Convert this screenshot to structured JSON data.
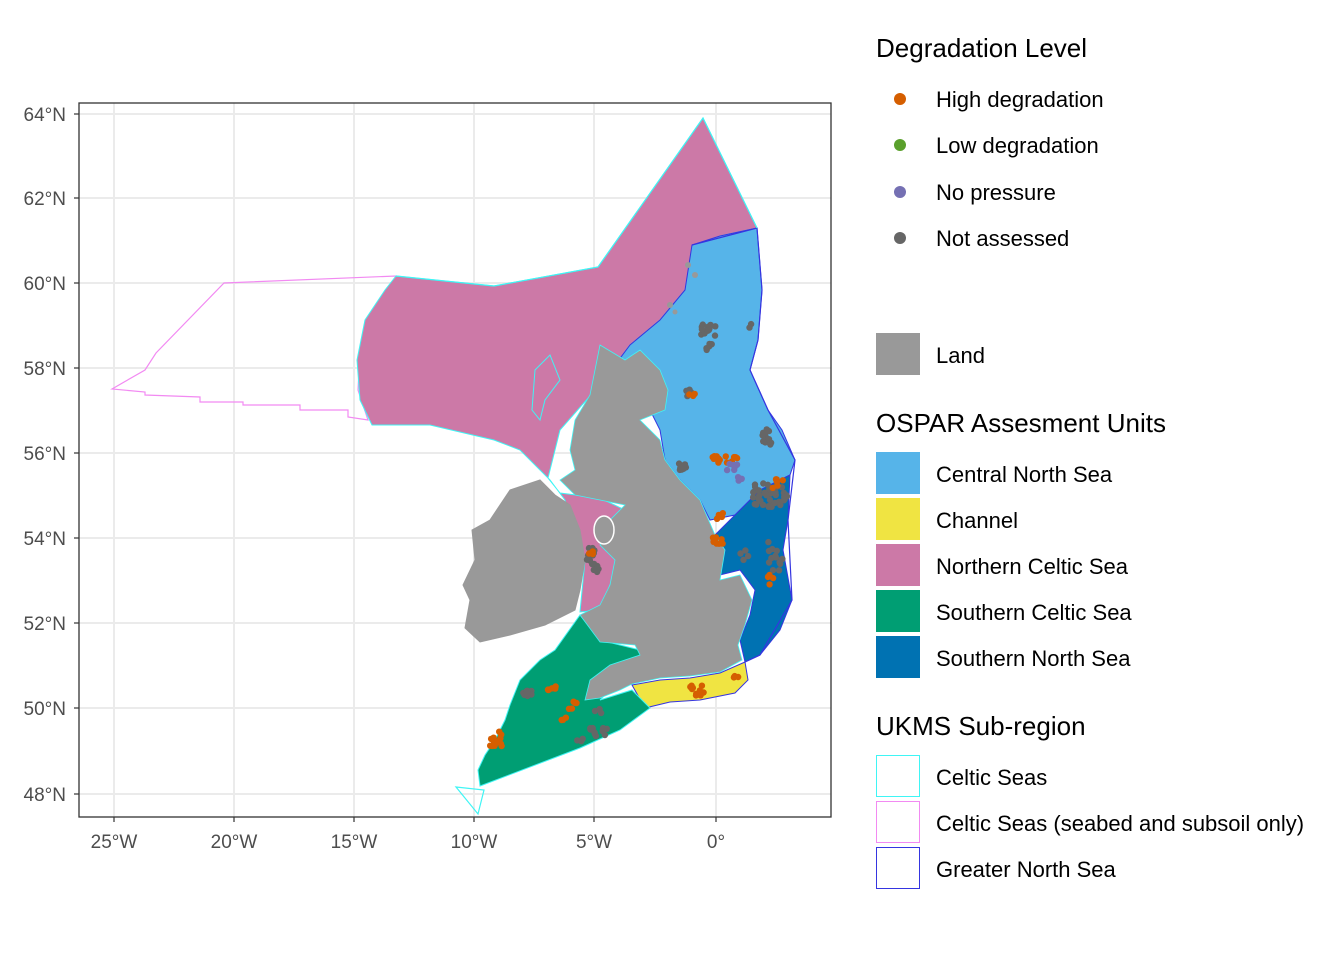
{
  "map": {
    "lat_ticks": [
      "48°N",
      "50°N",
      "52°N",
      "54°N",
      "56°N",
      "58°N",
      "60°N",
      "62°N",
      "64°N"
    ],
    "lon_ticks": [
      "25°W",
      "20°W",
      "15°W",
      "10°W",
      "5°W",
      "0°"
    ],
    "colors": {
      "land": "#999999",
      "central_north_sea": "#56b4e9",
      "channel": "#f0e442",
      "northern_celtic_sea": "#cc79a7",
      "southern_celtic_sea": "#009e73",
      "southern_north_sea": "#0072b2",
      "celtic_seas_outline": "#3ff5f5",
      "celtic_seas_seabed_outline": "#f28af2",
      "greater_north_sea_outline": "#3535e0",
      "high_degradation": "#d55e00",
      "low_degradation": "#5aa02c",
      "no_pressure": "#7570b3",
      "not_assessed": "#666666"
    }
  },
  "legend": {
    "degradation": {
      "title": "Degradation Level",
      "items": [
        {
          "label": "High degradation",
          "color": "#d55e00"
        },
        {
          "label": "Low degradation",
          "color": "#5aa02c"
        },
        {
          "label": "No pressure",
          "color": "#7570b3"
        },
        {
          "label": "Not assessed",
          "color": "#666666"
        }
      ]
    },
    "land": {
      "label": "Land",
      "color": "#999999"
    },
    "ospar": {
      "title": "OSPAR Assesment Units",
      "items": [
        {
          "label": "Central North Sea",
          "color": "#56b4e9"
        },
        {
          "label": "Channel",
          "color": "#f0e442"
        },
        {
          "label": "Northern Celtic Sea",
          "color": "#cc79a7"
        },
        {
          "label": "Southern Celtic Sea",
          "color": "#009e73"
        },
        {
          "label": "Southern North Sea",
          "color": "#0072b2"
        }
      ]
    },
    "ukms": {
      "title": "UKMS Sub-region",
      "items": [
        {
          "label": "Celtic Seas",
          "color": "#3ff5f5"
        },
        {
          "label": "Celtic Seas (seabed and subsoil only)",
          "color": "#f28af2"
        },
        {
          "label": "Greater North Sea",
          "color": "#3535e0"
        }
      ]
    }
  }
}
